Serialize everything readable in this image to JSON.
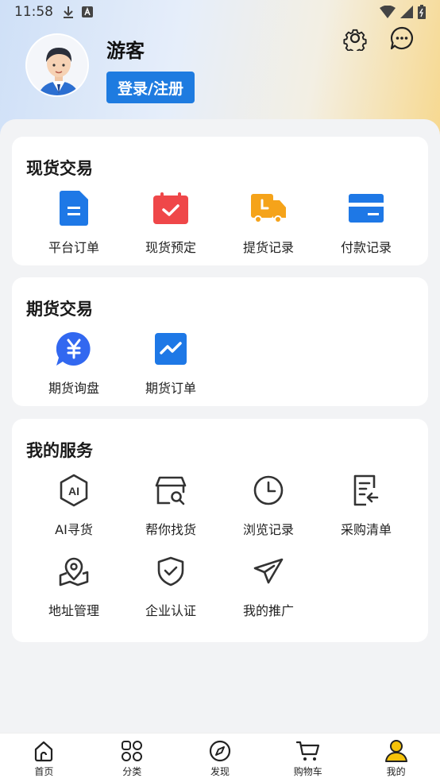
{
  "status_bar": {
    "time": "11:58"
  },
  "profile": {
    "username": "游客",
    "login_label": "登录/注册"
  },
  "colors": {
    "accent": "#1e7be0",
    "header_gradient_end": "#f7d88e"
  },
  "spot_trade": {
    "title": "现货交易",
    "items": [
      {
        "label": "平台订单",
        "icon": "document-icon"
      },
      {
        "label": "现货预定",
        "icon": "calendar-check-icon"
      },
      {
        "label": "提货记录",
        "icon": "truck-icon"
      },
      {
        "label": "付款记录",
        "icon": "card-icon"
      }
    ]
  },
  "futures_trade": {
    "title": "期货交易",
    "items": [
      {
        "label": "期货询盘",
        "icon": "yuan-chat-icon"
      },
      {
        "label": "期货订单",
        "icon": "trend-icon"
      }
    ]
  },
  "my_services": {
    "title": "我的服务",
    "items": [
      {
        "label": "AI寻货",
        "icon": "ai-hexagon-icon"
      },
      {
        "label": "帮你找货",
        "icon": "store-search-icon"
      },
      {
        "label": "浏览记录",
        "icon": "clock-icon"
      },
      {
        "label": "采购清单",
        "icon": "list-return-icon"
      },
      {
        "label": "地址管理",
        "icon": "map-pin-icon"
      },
      {
        "label": "企业认证",
        "icon": "shield-check-icon"
      },
      {
        "label": "我的推广",
        "icon": "paper-plane-icon"
      }
    ]
  },
  "tabbar": {
    "items": [
      {
        "label": "首页",
        "icon": "home-icon"
      },
      {
        "label": "分类",
        "icon": "category-icon"
      },
      {
        "label": "发现",
        "icon": "compass-icon"
      },
      {
        "label": "购物车",
        "icon": "cart-icon"
      },
      {
        "label": "我的",
        "icon": "user-icon",
        "active": true
      }
    ]
  }
}
